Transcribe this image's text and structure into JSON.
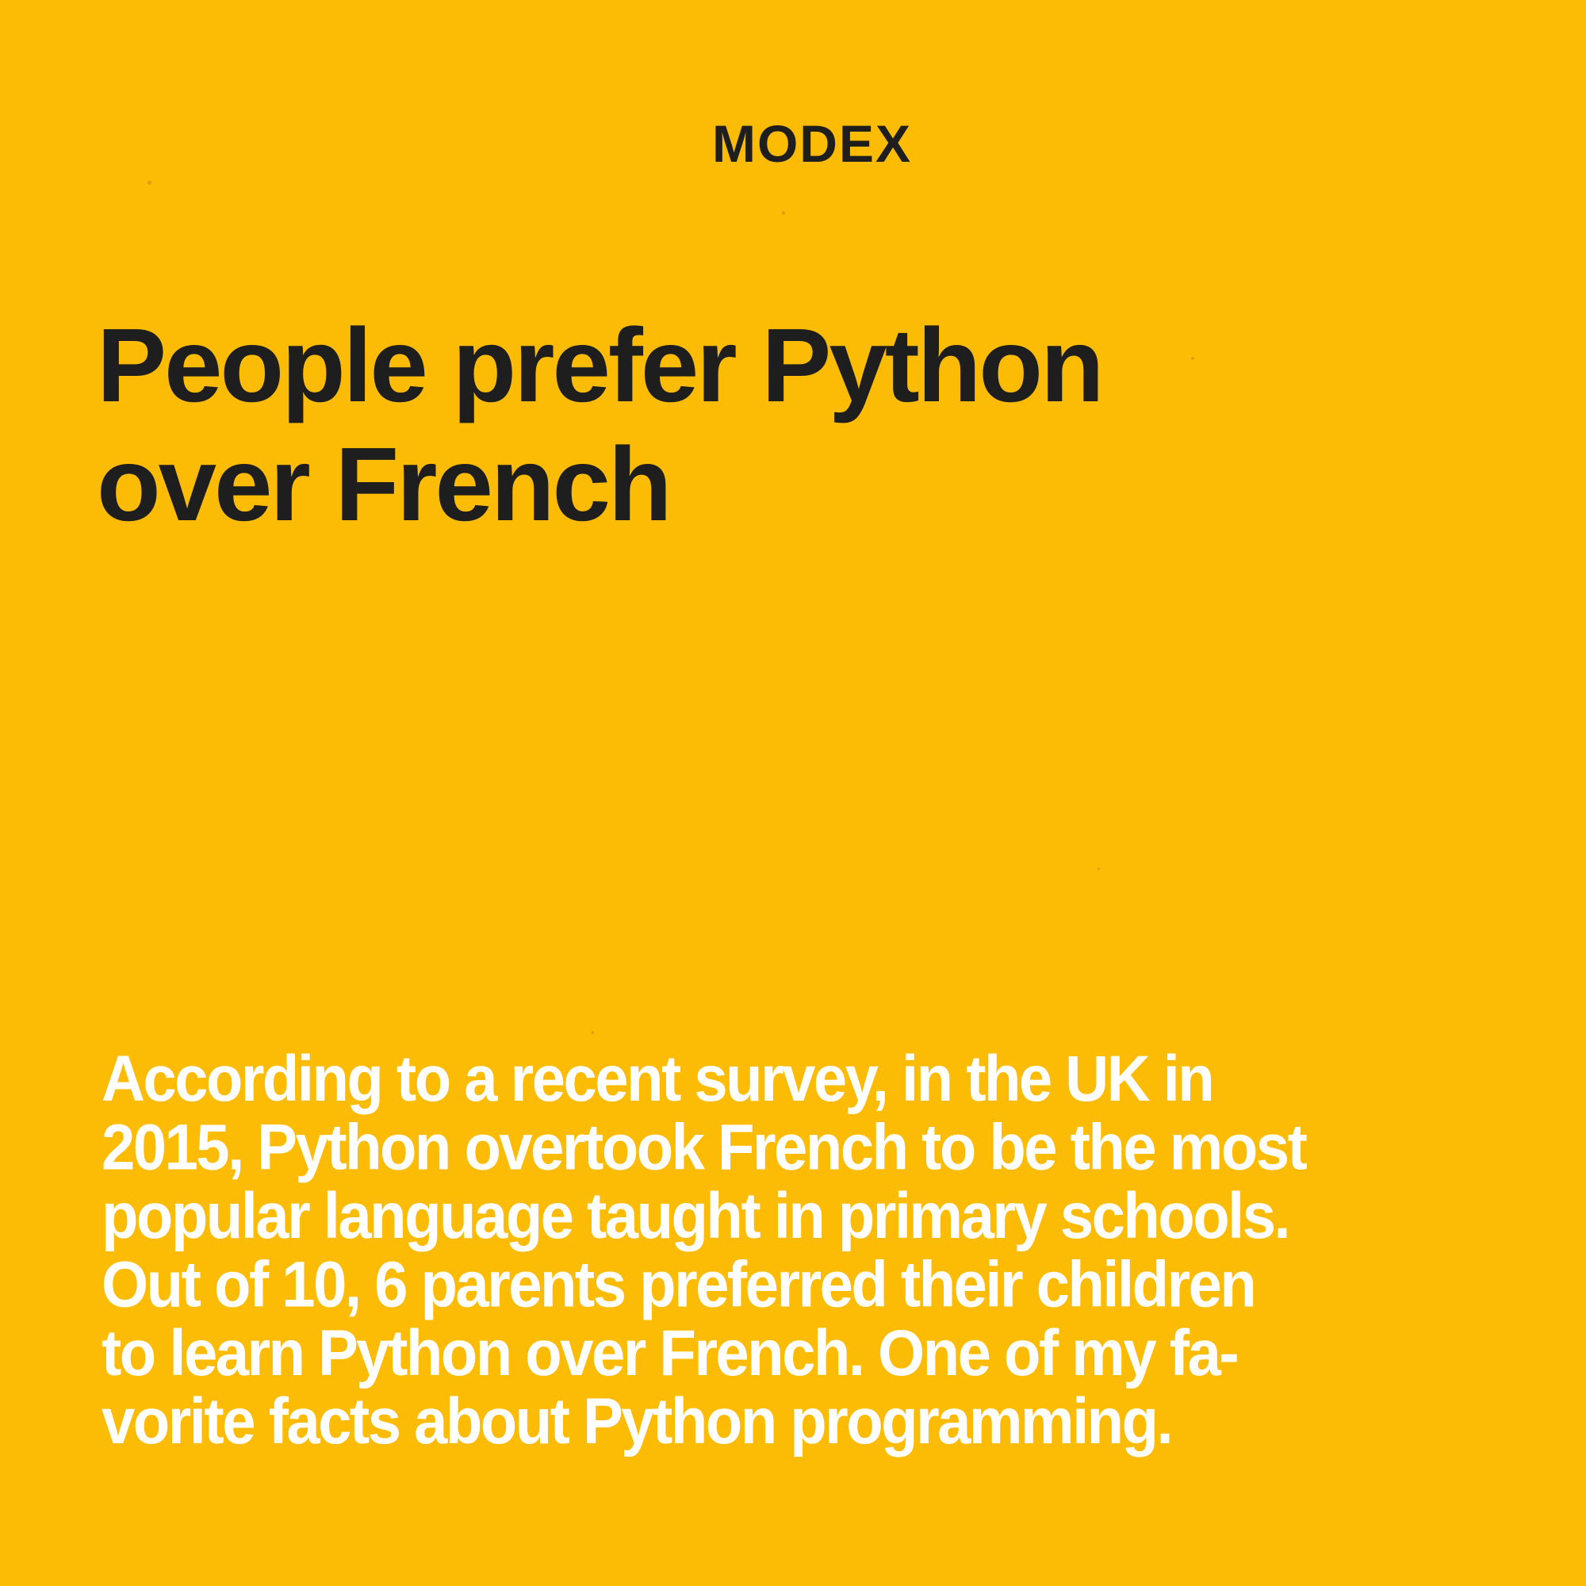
{
  "brand": {
    "name": "MODEX"
  },
  "headline": {
    "lines": [
      "People prefer Python",
      "over French"
    ]
  },
  "body": {
    "lines": [
      "According to a recent survey, in the UK in",
      "2015, Python overtook French to be the most",
      "popular language taught in primary schools.",
      "Out of 10, 6 parents preferred their children",
      "to learn Python over French. One of my fa-",
      "vorite facts about Python programming."
    ]
  },
  "colors": {
    "background": "#FCBC05",
    "heading_text": "#1E1E1E",
    "body_text": "#FFFFFF"
  }
}
